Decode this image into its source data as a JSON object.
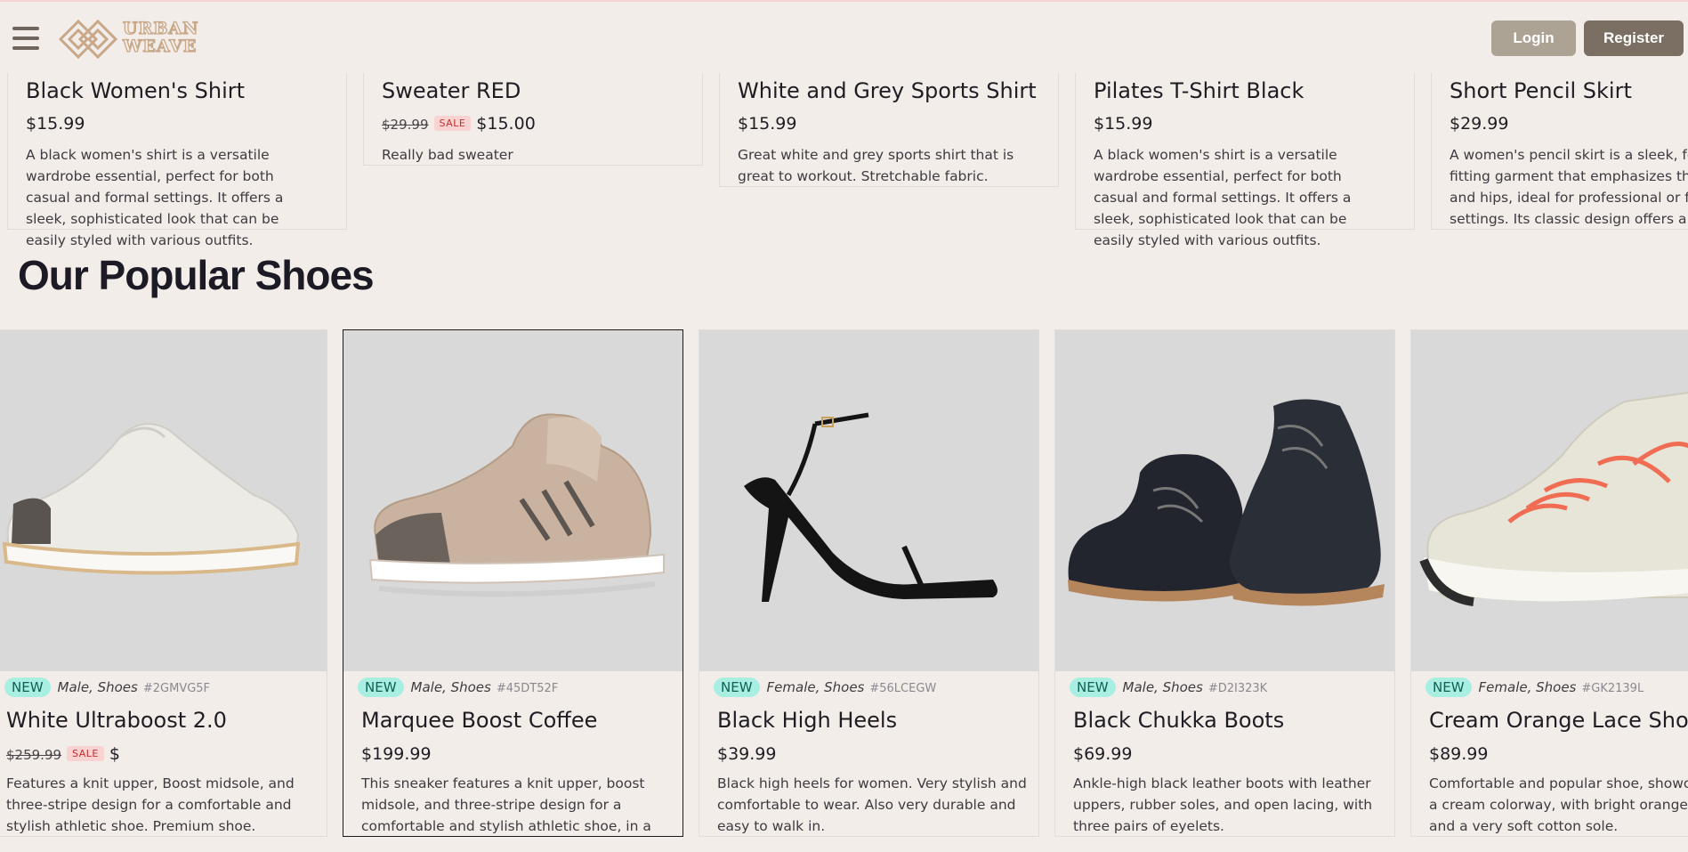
{
  "header": {
    "logo_line1": "URBAN",
    "logo_line2": "WEAVE",
    "login_label": "Login",
    "register_label": "Register"
  },
  "shirts": [
    {
      "name": "Black Women's Shirt",
      "price": "$15.99",
      "desc": "A black women's shirt is a versatile wardrobe essential, perfect for both casual and formal settings. It offers a sleek, sophisticated look that can be easily styled with various outfits."
    },
    {
      "name": "Sweater RED",
      "old_price": "$29.99",
      "sale_label": "SALE",
      "price": "$15.00",
      "desc": "Really bad sweater"
    },
    {
      "name": "White and Grey Sports Shirt",
      "price": "$15.99",
      "desc": "Great white and grey sports shirt that is great to workout. Stretchable fabric."
    },
    {
      "name": "Pilates T-Shirt Black",
      "price": "$15.99",
      "desc": "A black women's shirt is a versatile wardrobe essential, perfect for both casual and formal settings. It offers a sleek, sophisticated look that can be easily styled with various outfits."
    },
    {
      "name": "Short Pencil Skirt",
      "price": "$29.99",
      "desc": "A women's pencil skirt is a sleek, form-fitting garment that emphasizes the waist and hips, ideal for professional or formal settings. Its classic design offers a polished look."
    }
  ],
  "section_title": "Our Popular Shoes",
  "shoes": [
    {
      "badge": "NEW",
      "category": "Male, Shoes",
      "sku": "#2GMVG5F",
      "name": "White Ultraboost 2.0",
      "old_price": "$259.99",
      "sale_label": "SALE",
      "price": "$",
      "desc": "Features a knit upper, Boost midsole, and three-stripe design for a comfortable and stylish athletic shoe. Premium shoe."
    },
    {
      "badge": "NEW",
      "category": "Male, Shoes",
      "sku": "#45DT52F",
      "name": "Marquee Boost Coffee",
      "price": "$199.99",
      "desc": "This sneaker features a knit upper, boost midsole, and three-stripe design for a comfortable and stylish athletic shoe, in a cream and white colorway."
    },
    {
      "badge": "NEW",
      "category": "Female, Shoes",
      "sku": "#56LCEGW",
      "name": "Black High Heels",
      "price": "$39.99",
      "desc": "Black high heels for women. Very stylish and comfortable to wear. Also very durable and easy to walk in."
    },
    {
      "badge": "NEW",
      "category": "Male, Shoes",
      "sku": "#D2I323K",
      "name": "Black Chukka Boots",
      "price": "$69.99",
      "desc": "Ankle-high black leather boots with leather uppers, rubber soles, and open lacing, with three pairs of eyelets."
    },
    {
      "badge": "NEW",
      "category": "Female, Shoes",
      "sku": "#GK2139L",
      "name": "Cream Orange Lace Shoes",
      "price": "$89.99",
      "desc": "Comfortable and popular shoe, showcasing a cream colorway, with bright orange laces and a very soft cotton sole."
    }
  ],
  "colors": {
    "background": "#f2ede9",
    "login_button": "#ada395",
    "register_button": "#7b6e62",
    "new_badge": "#a8efe2",
    "sale_badge": "#f9d2d2",
    "image_bg": "#d9d9d9"
  }
}
